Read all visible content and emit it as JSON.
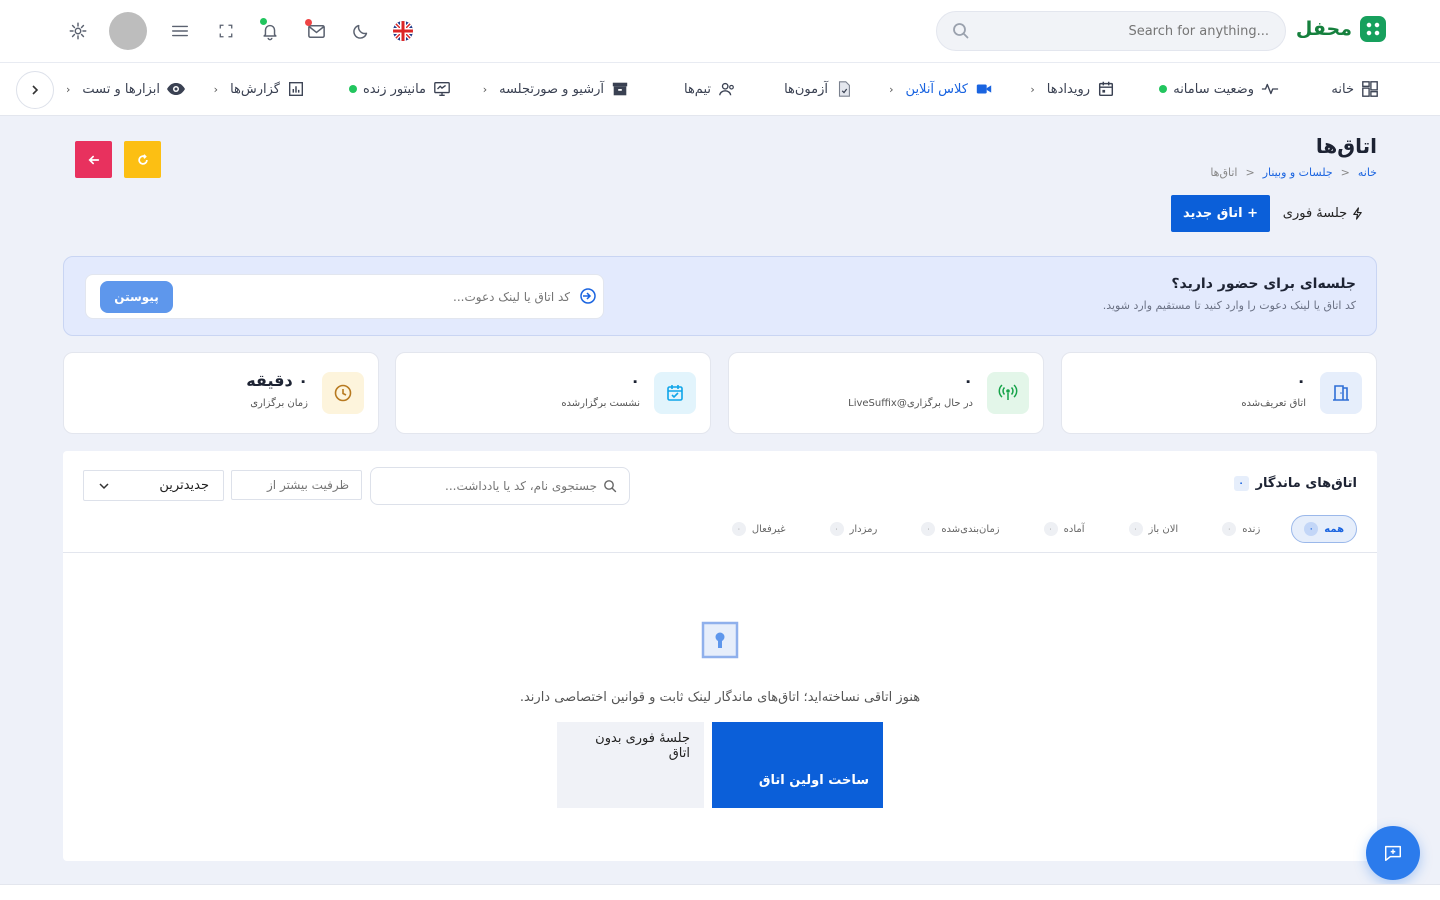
{
  "app": {
    "title": "محفل",
    "brand_color": "#17a05d"
  },
  "search": {
    "placeholder": "Search for anything..."
  },
  "topbar": {
    "language": "uk-flag",
    "notification_dot_color": "#22c55e",
    "mail_dot_color": "#ef4444"
  },
  "nav": {
    "items": [
      {
        "label": "خانه",
        "icon": "dashboard-icon"
      },
      {
        "label": "وضعیت سامانه",
        "icon": "activity-icon"
      },
      {
        "label": "رویدادها",
        "icon": "calendar-icon"
      },
      {
        "label": "کلاس آنلاین",
        "icon": "video-icon"
      },
      {
        "label": "آزمون‌ها",
        "icon": "exam-icon"
      },
      {
        "label": "تیم‌ها",
        "icon": "team-icon"
      },
      {
        "label": "آرشیو و صورتجلسه",
        "icon": "archive-icon"
      },
      {
        "label": "مانیتور زنده",
        "icon": "monitor-icon"
      },
      {
        "label": "گزارش‌ها",
        "icon": "report-icon"
      },
      {
        "label": "ابزارها و تست",
        "icon": "eye-icon"
      }
    ]
  },
  "page": {
    "title": "اتاق‌ها",
    "breadcrumb": [
      "خانه",
      "جلسات و وبینار",
      "اتاق‌ها"
    ],
    "new_room": "+ اتاق جدید",
    "instant_meeting": "جلسهٔ فوری"
  },
  "join": {
    "title": "جلسه‌ای برای حضور دارید؟",
    "subtitle": "کد اتاق یا لینک دعوت را وارد کنید تا مستقیم وارد شوید.",
    "placeholder": "کد اتاق یا لینک دعوت...",
    "button": "پیوستن"
  },
  "stats": [
    {
      "value": "۰",
      "label": "اتاق تعریف‌شده",
      "icon": "door-icon",
      "color": "#2f6fd6",
      "bg": "#e6eefb"
    },
    {
      "value": "۰",
      "label": "در حال برگزاری@LiveSuffix",
      "icon": "broadcast-icon",
      "color": "#16a34a",
      "bg": "#e3f6e9"
    },
    {
      "value": "۰",
      "label": "نشست برگزارشده",
      "icon": "calendar-check-icon",
      "color": "#0ea5e9",
      "bg": "#e2f4fc"
    },
    {
      "value": "۰ دقیقه",
      "label": "زمان برگزاری",
      "icon": "clock-icon",
      "color": "#b7791f",
      "bg": "#fdf4dc"
    }
  ],
  "rooms": {
    "title": "اتاق‌های ماندگار",
    "count": "۰",
    "search_placeholder": "جستجوی نام، کد یا یادداشت...",
    "capacity_placeholder": "ظرفیت بیشتر از",
    "sort_value": "جدیدترین",
    "filters": [
      {
        "label": "همه",
        "count": "۰"
      },
      {
        "label": "زنده",
        "count": "۰"
      },
      {
        "label": "الان باز",
        "count": "۰"
      },
      {
        "label": "آماده",
        "count": "۰"
      },
      {
        "label": "زمان‌بندی‌شده",
        "count": "۰"
      },
      {
        "label": "رمزدار",
        "count": "۰"
      },
      {
        "label": "غیرفعال",
        "count": "۰"
      }
    ],
    "empty_text": "هنوز اتاقی نساخته‌اید؛ اتاق‌های ماندگار لینک ثابت و قوانین اختصاصی دارند.",
    "create_first": "ساخت اولین اتاق",
    "instant_no_room": "جلسهٔ فوری بدون اتاق"
  }
}
